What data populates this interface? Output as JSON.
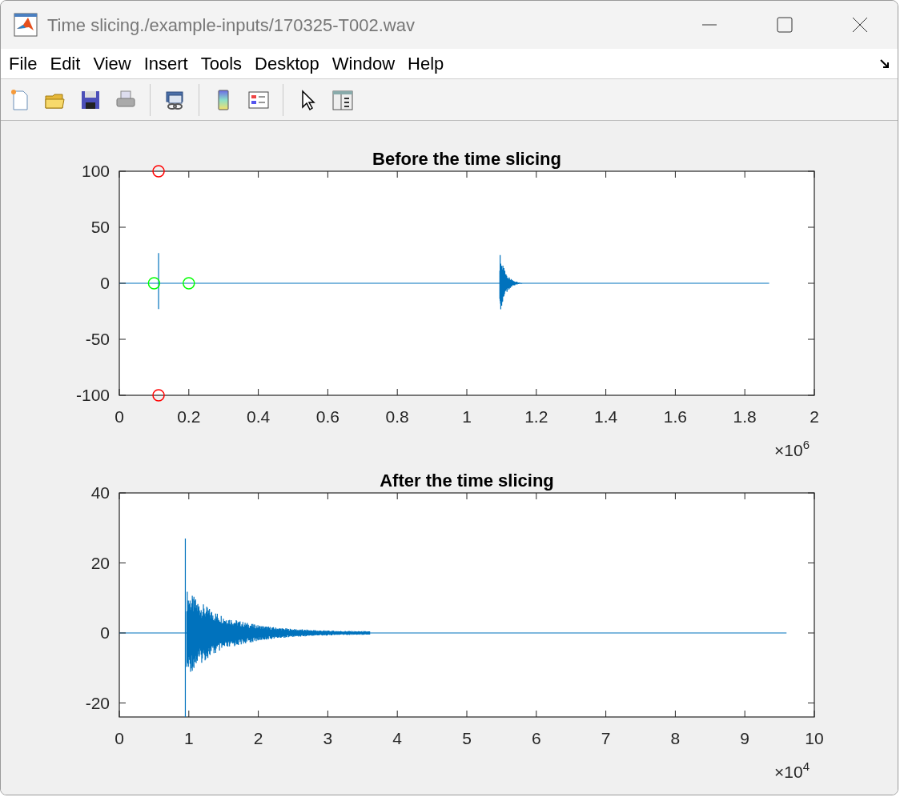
{
  "window": {
    "title": "Time slicing./example-inputs/170325-T002.wav"
  },
  "menu": [
    "File",
    "Edit",
    "View",
    "Insert",
    "Tools",
    "Desktop",
    "Window",
    "Help"
  ],
  "plots": [
    {
      "title": "Before the time slicing",
      "x_tick_labels": [
        "0",
        "0.2",
        "0.4",
        "0.6",
        "0.8",
        "1",
        "1.2",
        "1.4",
        "1.6",
        "1.8",
        "2"
      ],
      "y_tick_labels": [
        "100",
        "50",
        "0",
        "-50",
        "-100"
      ],
      "exponent": {
        "base": "×10",
        "power": "6"
      }
    },
    {
      "title": "After the time slicing",
      "x_tick_labels": [
        "0",
        "1",
        "2",
        "3",
        "4",
        "5",
        "6",
        "7",
        "8",
        "9",
        "10"
      ],
      "y_tick_labels": [
        "40",
        "20",
        "0",
        "-20"
      ],
      "exponent": {
        "base": "×10",
        "power": "4"
      }
    }
  ]
}
